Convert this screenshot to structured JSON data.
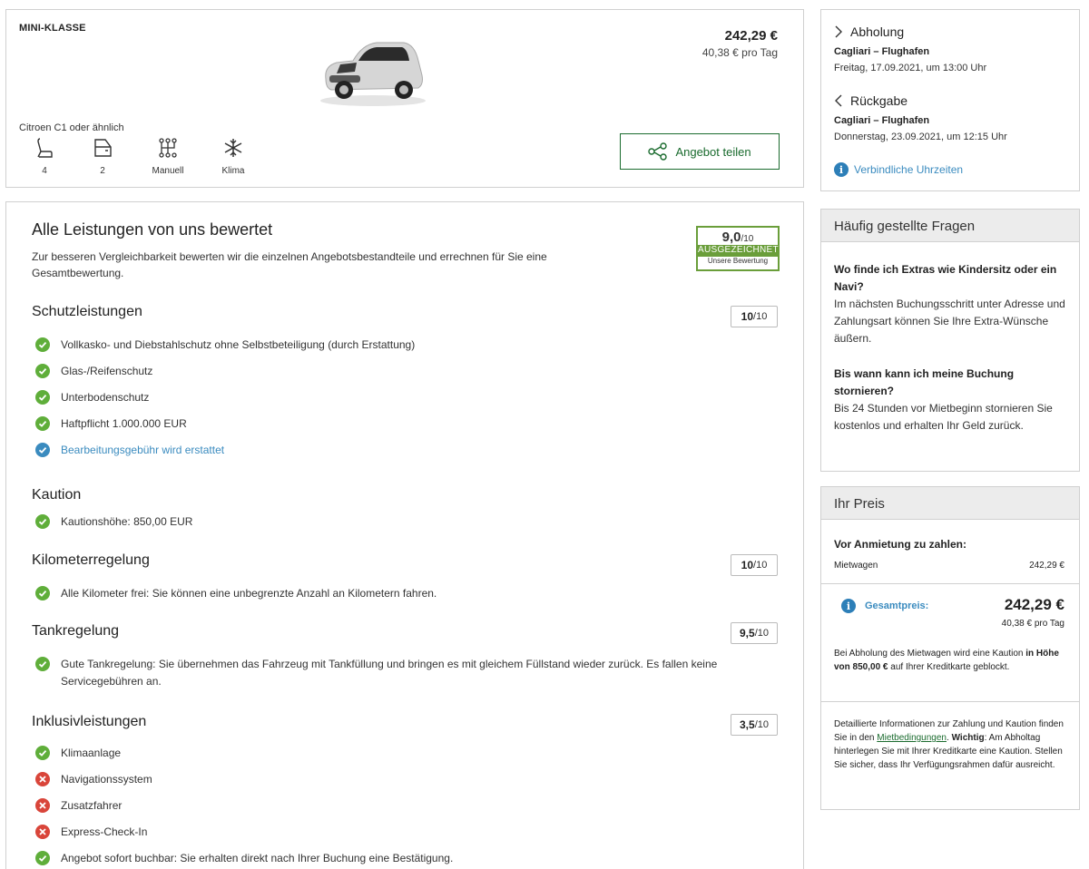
{
  "car": {
    "class": "MINI-KLASSE",
    "price": "242,29 €",
    "price_per_day": "40,38 € pro Tag",
    "model": "Citroen C1 oder ähnlich",
    "specs": [
      {
        "icon": "seat-icon",
        "label": "4"
      },
      {
        "icon": "door-icon",
        "label": "2"
      },
      {
        "icon": "gearshift-icon",
        "label": "Manuell"
      },
      {
        "icon": "snowflake-icon",
        "label": "Klima"
      }
    ],
    "share_label": "Angebot teilen"
  },
  "services": {
    "title": "Alle Leistungen von uns bewertet",
    "description": "Zur besseren Vergleichbarkeit bewerten wir die einzelnen Angebotsbestandteile und errechnen für Sie eine Gesamtbewertung.",
    "rating": {
      "score": "9,0",
      "denom": "/10",
      "label": "AUSGEZEICHNET",
      "sub": "Unsere Bewertung",
      "color": "#6a9e3a"
    },
    "sections": {
      "schutz": {
        "title": "Schutzleistungen",
        "score": "10",
        "denom": "/10",
        "items": [
          "Vollkasko- und Diebstahlschutz ohne Selbstbeteiligung (durch Erstattung)",
          "Glas-/Reifenschutz",
          "Unterbodenschutz",
          "Haftpflicht 1.000.000 EUR",
          "Bearbeitungsgebühr wird erstattet"
        ]
      },
      "kaution": {
        "title": "Kaution",
        "items": [
          "Kautionshöhe: 850,00 EUR"
        ]
      },
      "km": {
        "title": "Kilometerregelung",
        "score": "10",
        "denom": "/10",
        "items": [
          "Alle Kilometer frei: Sie können eine unbegrenzte Anzahl an Kilometern fahren."
        ]
      },
      "tank": {
        "title": "Tankregelung",
        "score": "9,5",
        "denom": "/10",
        "items": [
          "Gute Tankregelung: Sie übernehmen das Fahrzeug mit Tankfüllung und bringen es mit gleichem Füllstand wieder zurück. Es fallen keine Servicegebühren an."
        ]
      },
      "inkl": {
        "title": "Inklusivleistungen",
        "score": "3,5",
        "denom": "/10",
        "items": [
          "Klimaanlage",
          "Navigationssystem",
          "Zusatzfahrer",
          "Express-Check-In",
          "Angebot sofort buchbar: Sie erhalten direkt nach Ihrer Buchung eine Bestätigung."
        ]
      }
    }
  },
  "pickup": {
    "pickup_label": "Abholung",
    "pickup_location": "Cagliari – Flughafen",
    "pickup_date": "Freitag, 17.09.2021, um 13:00 Uhr",
    "return_label": "Rückgabe",
    "return_location": "Cagliari – Flughafen",
    "return_date": "Donnerstag, 23.09.2021, um 12:15 Uhr",
    "times_link": "Verbindliche Uhrzeiten"
  },
  "faq": {
    "title": "Häufig gestellte Fragen",
    "q1": "Wo finde ich Extras wie Kindersitz oder ein Navi?",
    "a1": "Im nächsten Buchungsschritt unter Adresse und Zahlungsart können Sie Ihre Extra-Wünsche äußern.",
    "q2": "Bis wann kann ich meine Buchung stornieren?",
    "a2": "Bis 24 Stunden vor Mietbeginn stornieren Sie kostenlos und erhalten Ihr Geld zurück."
  },
  "price": {
    "title": "Ihr Preis",
    "subtitle": "Vor Anmietung zu zahlen:",
    "row_label": "Mietwagen",
    "row_value": "242,29 €",
    "total_label": "Gesamtpreis:",
    "total_value": "242,29 €",
    "total_day": "40,38 € pro Tag",
    "deposit_pre": "Bei Abholung des Mietwagen wird eine Kaution ",
    "deposit_bold": "in Höhe von 850,00 €",
    "deposit_post": " auf Ihrer Kreditkarte geblockt.",
    "info_pre": "Detaillierte Informationen zur Zahlung und Kaution finden Sie in den ",
    "info_link": "Mietbedingungen",
    "info_mid": ". ",
    "info_bold": "Wichtig",
    "info_post": ": Am Abholtag hinterlegen Sie mit Ihrer Kreditkarte eine Kaution. Stellen Sie sicher, dass Ihr Verfügungsrahmen dafür ausreicht."
  },
  "colors": {
    "green_check": "#5fae3a",
    "blue_check": "#3a8bbf",
    "red_cross": "#d9453a",
    "accent": "#1a6b2e"
  }
}
